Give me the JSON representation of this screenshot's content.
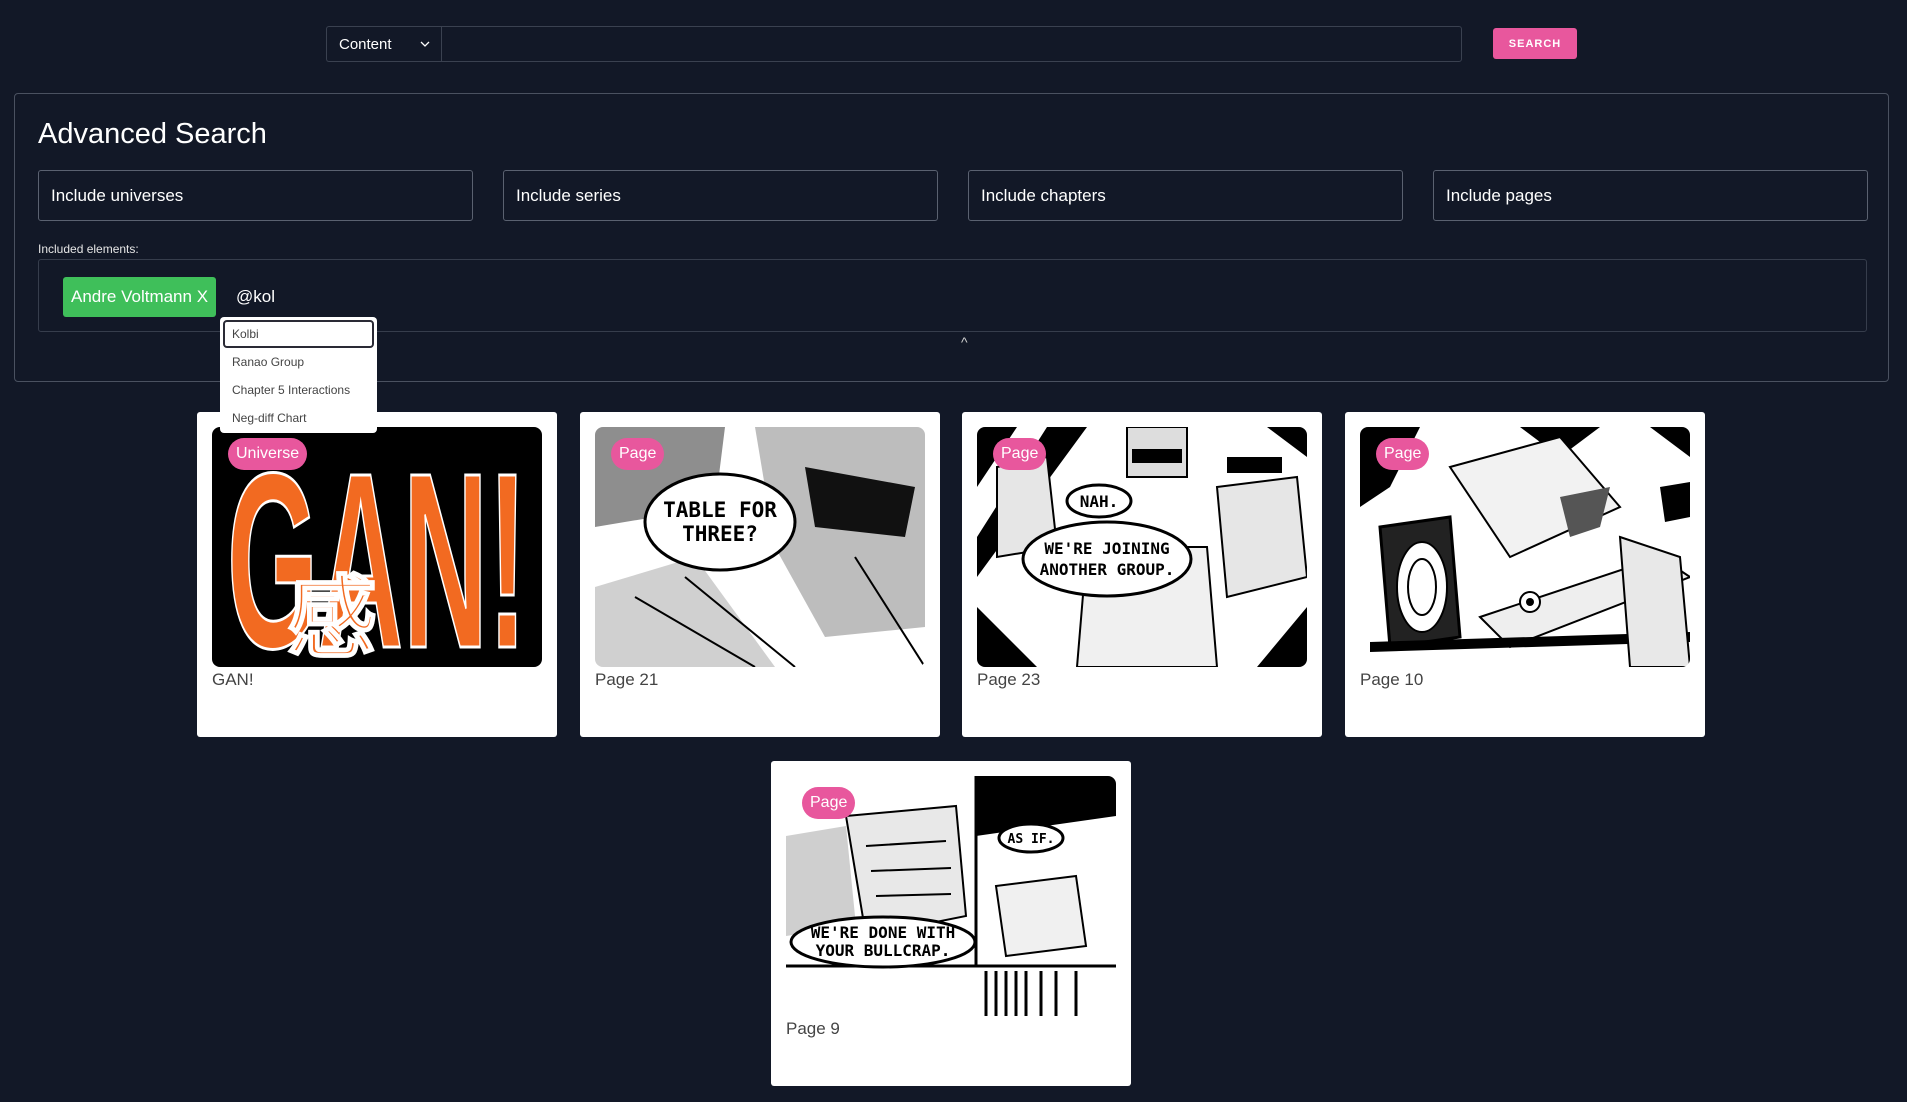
{
  "search": {
    "scope_value": "Content",
    "query_value": "",
    "button_label": "SEARCH"
  },
  "advanced": {
    "title": "Advanced Search",
    "fields": [
      "Include universes",
      "Include series",
      "Include chapters",
      "Include pages"
    ],
    "included_label": "Included elements:",
    "chips": [
      "Andre Voltmann X"
    ],
    "typed_value": "@kol",
    "collapse_glyph": "^"
  },
  "autocomplete": {
    "options": [
      "Kolbi",
      "Ranao Group",
      "Chapter 5 Interactions",
      "Neg-diff Chart"
    ],
    "active_index": 0
  },
  "results": [
    {
      "badge": "Universe",
      "label": "GAN!",
      "logo_text": "GAN!",
      "kanji": "感"
    },
    {
      "badge": "Page",
      "label": "Page 21",
      "bubbles": [
        "TABLE FOR",
        "THREE?"
      ]
    },
    {
      "badge": "Page",
      "label": "Page 23",
      "bubbles": [
        "NAH.",
        "WE'RE JOINING",
        "ANOTHER GROUP."
      ]
    },
    {
      "badge": "Page",
      "label": "Page 10"
    },
    {
      "badge": "Page",
      "label": "Page 9",
      "bubbles": [
        "AS IF.",
        "WE'RE DONE WITH",
        "YOUR BULLCRAP."
      ]
    }
  ],
  "colors": {
    "background": "#121827",
    "accent_pink": "#e8579d",
    "chip_green": "#3fbf5a",
    "gan_orange": "#f26a21"
  }
}
